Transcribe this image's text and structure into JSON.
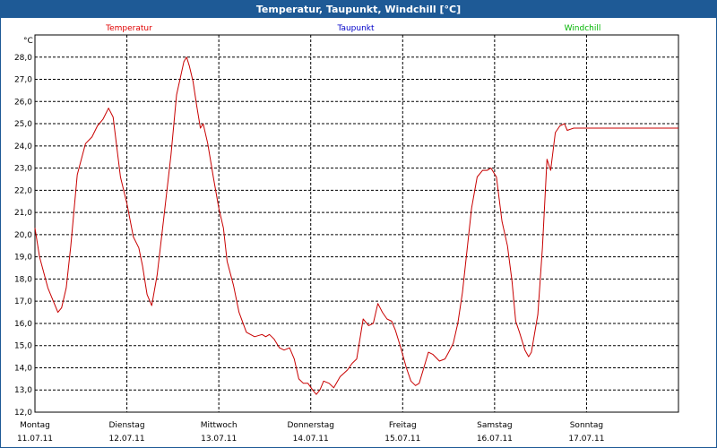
{
  "window": {
    "title": "Temperatur, Taupunkt, Windchill [°C]"
  },
  "chart_data": {
    "type": "line",
    "title": "Temperatur, Taupunkt, Windchill [°C]",
    "ylabel": "°C",
    "ylim": [
      12.0,
      29.0
    ],
    "yticks": [
      "12,0",
      "13,0",
      "14,0",
      "15,0",
      "16,0",
      "17,0",
      "18,0",
      "19,0",
      "20,0",
      "21,0",
      "22,0",
      "23,0",
      "24,0",
      "25,0",
      "26,0",
      "27,0",
      "28,0"
    ],
    "xlim": [
      0,
      7
    ],
    "days": [
      {
        "name": "Montag",
        "date": "11.07.11"
      },
      {
        "name": "Dienstag",
        "date": "12.07.11"
      },
      {
        "name": "Mittwoch",
        "date": "13.07.11"
      },
      {
        "name": "Donnerstag",
        "date": "14.07.11"
      },
      {
        "name": "Freitag",
        "date": "15.07.11"
      },
      {
        "name": "Samstag",
        "date": "16.07.11"
      },
      {
        "name": "Sonntag",
        "date": "17.07.11"
      }
    ],
    "legend": [
      {
        "name": "Temperatur",
        "color": "#e00000"
      },
      {
        "name": "Taupunkt",
        "color": "#0000c8"
      },
      {
        "name": "Windchill",
        "color": "#00b400"
      }
    ],
    "grid": true,
    "series": [
      {
        "name": "Temperatur",
        "color": "#c80000",
        "points": [
          [
            0.0,
            20.3
          ],
          [
            0.05,
            19.0
          ],
          [
            0.14,
            17.6
          ],
          [
            0.25,
            16.5
          ],
          [
            0.29,
            16.7
          ],
          [
            0.34,
            17.6
          ],
          [
            0.39,
            19.5
          ],
          [
            0.46,
            22.7
          ],
          [
            0.55,
            24.1
          ],
          [
            0.62,
            24.4
          ],
          [
            0.68,
            24.9
          ],
          [
            0.74,
            25.2
          ],
          [
            0.8,
            25.7
          ],
          [
            0.85,
            25.3
          ],
          [
            0.93,
            22.6
          ],
          [
            1.0,
            21.4
          ],
          [
            1.07,
            19.9
          ],
          [
            1.13,
            19.4
          ],
          [
            1.17,
            18.6
          ],
          [
            1.22,
            17.3
          ],
          [
            1.27,
            16.8
          ],
          [
            1.33,
            18.2
          ],
          [
            1.4,
            20.7
          ],
          [
            1.48,
            23.6
          ],
          [
            1.54,
            26.3
          ],
          [
            1.62,
            27.8
          ],
          [
            1.65,
            28.0
          ],
          [
            1.68,
            27.6
          ],
          [
            1.72,
            26.9
          ],
          [
            1.76,
            25.8
          ],
          [
            1.8,
            24.8
          ],
          [
            1.83,
            25.0
          ],
          [
            1.88,
            24.1
          ],
          [
            1.94,
            22.6
          ],
          [
            2.0,
            21.2
          ],
          [
            2.05,
            20.3
          ],
          [
            2.09,
            18.8
          ],
          [
            2.16,
            17.7
          ],
          [
            2.22,
            16.5
          ],
          [
            2.3,
            15.6
          ],
          [
            2.39,
            15.4
          ],
          [
            2.47,
            15.5
          ],
          [
            2.51,
            15.4
          ],
          [
            2.55,
            15.5
          ],
          [
            2.6,
            15.3
          ],
          [
            2.66,
            14.9
          ],
          [
            2.71,
            14.8
          ],
          [
            2.77,
            14.9
          ],
          [
            2.82,
            14.4
          ],
          [
            2.87,
            13.5
          ],
          [
            2.92,
            13.3
          ],
          [
            2.97,
            13.3
          ],
          [
            3.02,
            13.0
          ],
          [
            3.06,
            12.8
          ],
          [
            3.1,
            13.0
          ],
          [
            3.14,
            13.4
          ],
          [
            3.2,
            13.3
          ],
          [
            3.25,
            13.1
          ],
          [
            3.32,
            13.6
          ],
          [
            3.4,
            13.9
          ],
          [
            3.45,
            14.2
          ],
          [
            3.5,
            14.4
          ],
          [
            3.57,
            16.2
          ],
          [
            3.63,
            15.9
          ],
          [
            3.68,
            16.0
          ],
          [
            3.73,
            16.9
          ],
          [
            3.78,
            16.5
          ],
          [
            3.83,
            16.2
          ],
          [
            3.88,
            16.1
          ],
          [
            3.92,
            15.7
          ],
          [
            3.98,
            14.9
          ],
          [
            4.04,
            14.0
          ],
          [
            4.09,
            13.4
          ],
          [
            4.14,
            13.2
          ],
          [
            4.18,
            13.3
          ],
          [
            4.23,
            14.0
          ],
          [
            4.28,
            14.7
          ],
          [
            4.33,
            14.6
          ],
          [
            4.4,
            14.3
          ],
          [
            4.46,
            14.4
          ],
          [
            4.5,
            14.7
          ],
          [
            4.55,
            15.1
          ],
          [
            4.6,
            16.0
          ],
          [
            4.65,
            17.4
          ],
          [
            4.7,
            19.3
          ],
          [
            4.75,
            21.2
          ],
          [
            4.81,
            22.6
          ],
          [
            4.87,
            22.9
          ],
          [
            4.92,
            22.9
          ],
          [
            4.96,
            23.0
          ],
          [
            5.02,
            22.6
          ],
          [
            5.08,
            20.6
          ],
          [
            5.14,
            19.5
          ],
          [
            5.19,
            17.9
          ],
          [
            5.23,
            16.1
          ],
          [
            5.27,
            15.6
          ],
          [
            5.33,
            14.8
          ],
          [
            5.37,
            14.5
          ],
          [
            5.4,
            14.7
          ],
          [
            5.47,
            16.4
          ],
          [
            5.52,
            19.4
          ],
          [
            5.57,
            23.4
          ],
          [
            5.61,
            22.9
          ],
          [
            5.66,
            24.6
          ],
          [
            5.71,
            24.9
          ],
          [
            5.76,
            25.0
          ],
          [
            5.79,
            24.7
          ],
          [
            5.86,
            24.8
          ],
          [
            6.1,
            24.8
          ],
          [
            6.5,
            24.8
          ],
          [
            7.0,
            24.8
          ]
        ]
      }
    ]
  }
}
